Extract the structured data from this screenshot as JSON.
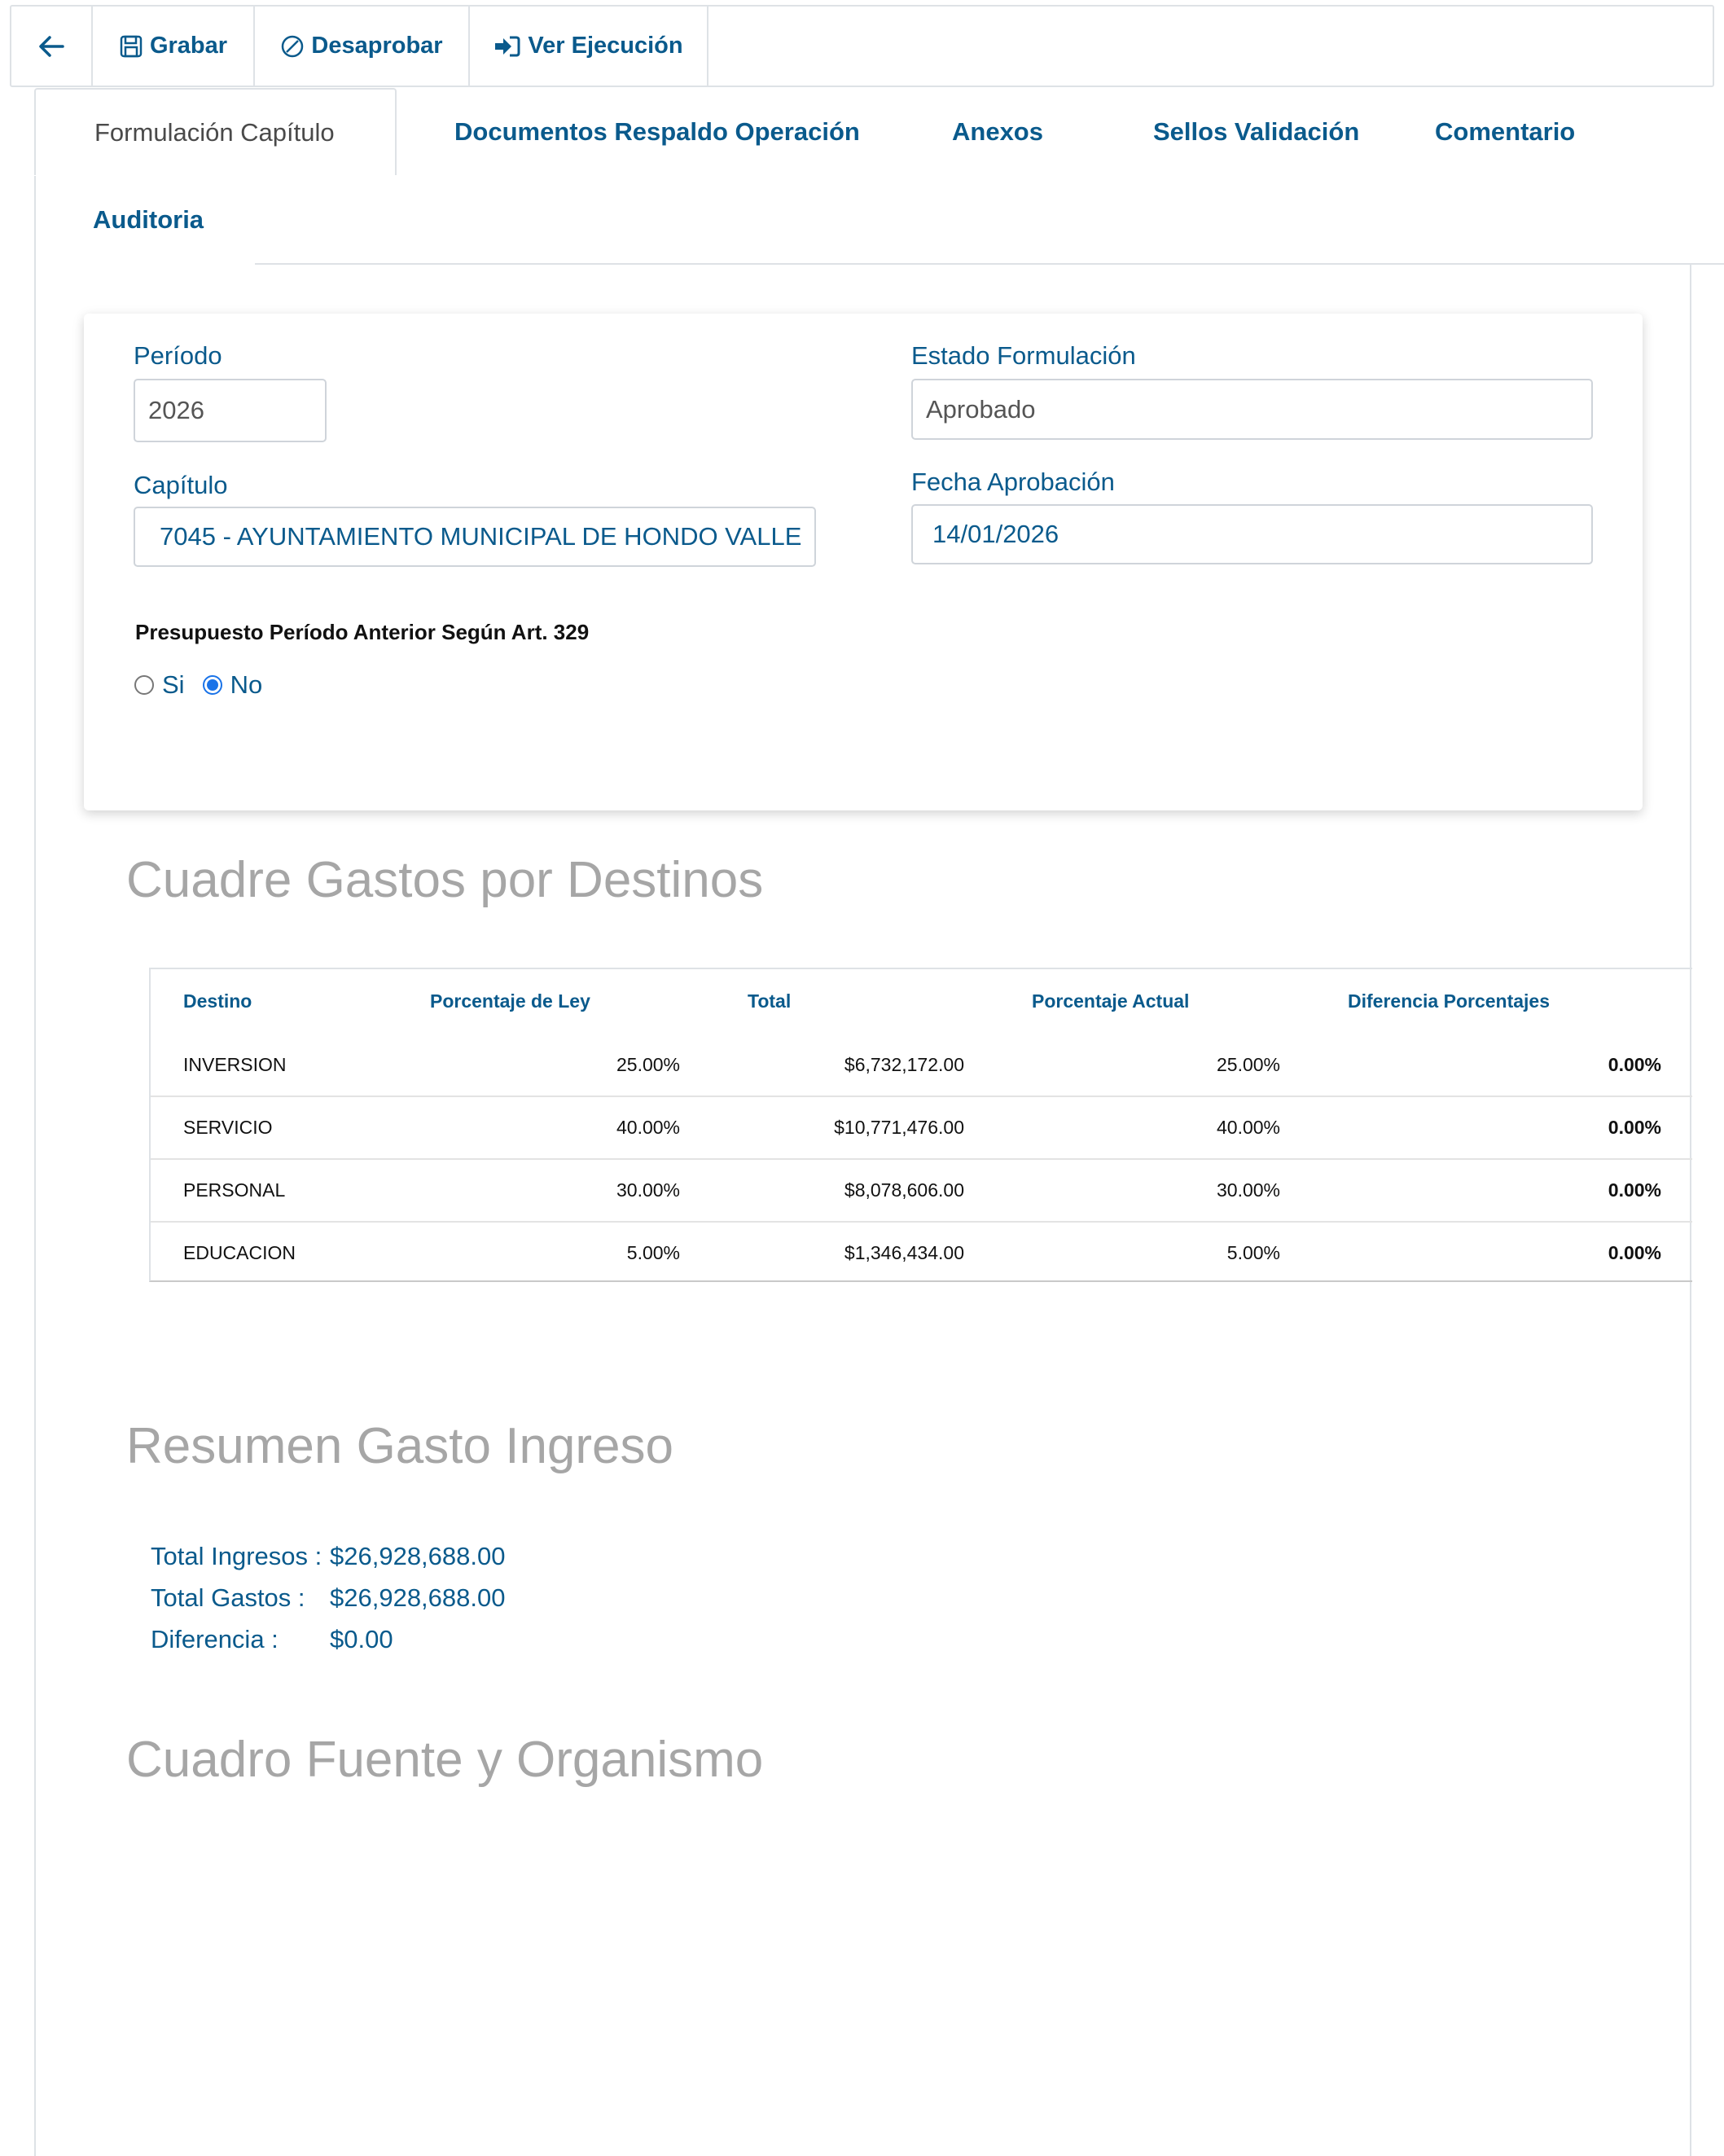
{
  "toolbar": {
    "grabar": "Grabar",
    "desaprobar": "Desaprobar",
    "ver_ejecucion": "Ver Ejecución"
  },
  "tabs": [
    {
      "label": "Formulación Capítulo",
      "active": true
    },
    {
      "label": "Documentos Respaldo Operación",
      "active": false
    },
    {
      "label": "Anexos",
      "active": false
    },
    {
      "label": "Sellos Validación",
      "active": false
    },
    {
      "label": "Comentario",
      "active": false
    },
    {
      "label": "Auditoria",
      "active": false
    }
  ],
  "form": {
    "periodo_label": "Período",
    "periodo_value": "2026",
    "estado_label": "Estado Formulación",
    "estado_value": "Aprobado",
    "capitulo_label": "Capítulo",
    "capitulo_value": "7045 - AYUNTAMIENTO MUNICIPAL DE HONDO VALLE",
    "fecha_label": "Fecha Aprobación",
    "fecha_value": "14/01/2026",
    "presupuesto_label": "Presupuesto Período Anterior Según Art. 329",
    "radio_si": "Si",
    "radio_no": "No",
    "radio_selected": "No"
  },
  "cuadre": {
    "title": "Cuadre Gastos por Destinos",
    "headers": [
      "Destino",
      "Porcentaje de Ley",
      "Total",
      "Porcentaje Actual",
      "Diferencia Porcentajes"
    ],
    "rows": [
      [
        "INVERSION",
        "25.00%",
        "$6,732,172.00",
        "25.00%",
        "0.00%"
      ],
      [
        "SERVICIO",
        "40.00%",
        "$10,771,476.00",
        "40.00%",
        "0.00%"
      ],
      [
        "PERSONAL",
        "30.00%",
        "$8,078,606.00",
        "30.00%",
        "0.00%"
      ],
      [
        "EDUCACION",
        "5.00%",
        "$1,346,434.00",
        "5.00%",
        "0.00%"
      ]
    ]
  },
  "resumen": {
    "title": "Resumen Gasto Ingreso",
    "total_ingresos_label": "Total Ingresos :",
    "total_ingresos_value": "$26,928,688.00",
    "total_gastos_label": "Total Gastos :",
    "total_gastos_value": "$26,928,688.00",
    "diferencia_label": "Diferencia :",
    "diferencia_value": "$0.00"
  },
  "fuente": {
    "title": "Cuadro Fuente y Organismo"
  },
  "colors": {
    "accent": "#0a5a8c",
    "section_title": "#a6a6a6",
    "border": "#dee2e6",
    "radio_checked": "#1a73e8"
  },
  "icons": [
    "arrow-left-icon",
    "floppy-disk-icon",
    "ban-circle-icon",
    "sign-in-arrow-icon"
  ]
}
